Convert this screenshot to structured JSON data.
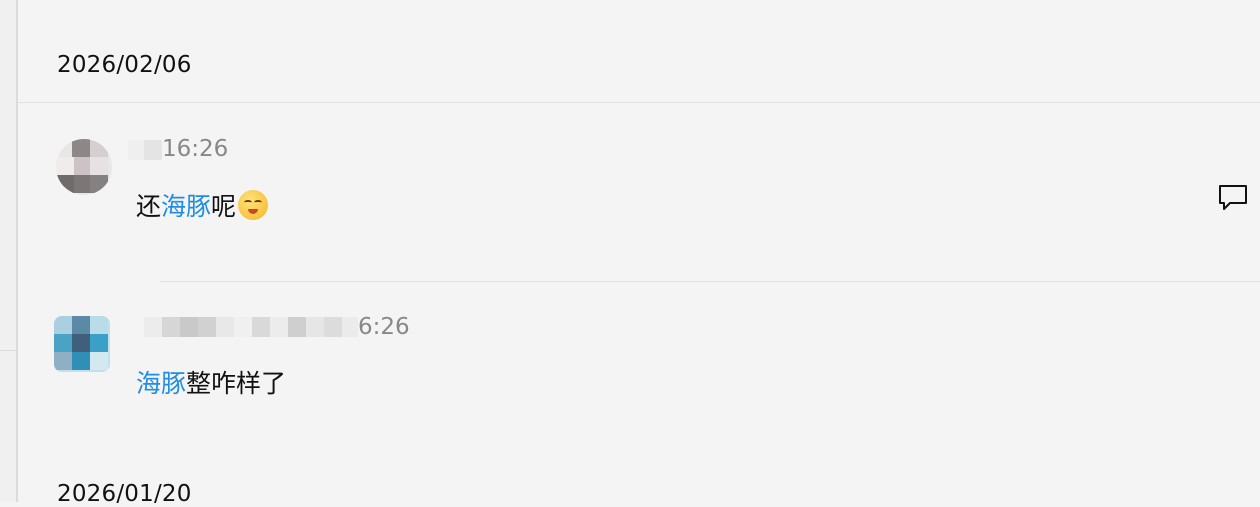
{
  "dates": {
    "first": "2026/02/06",
    "second": "2026/01/20"
  },
  "comments": [
    {
      "time": "16:26",
      "text_before": "还",
      "mention": "海豚",
      "text_after": "呢",
      "emoji": "smirking-face-emoji"
    },
    {
      "time": "6:26",
      "text_before": "",
      "mention": "海豚",
      "text_after": "整咋样了"
    }
  ],
  "icons": {
    "reply": "comment-bubble-icon"
  },
  "colors": {
    "background": "#f4f4f4",
    "mention": "#1f8ce6",
    "timestamp": "#888888",
    "divider": "#e3e3e3"
  }
}
